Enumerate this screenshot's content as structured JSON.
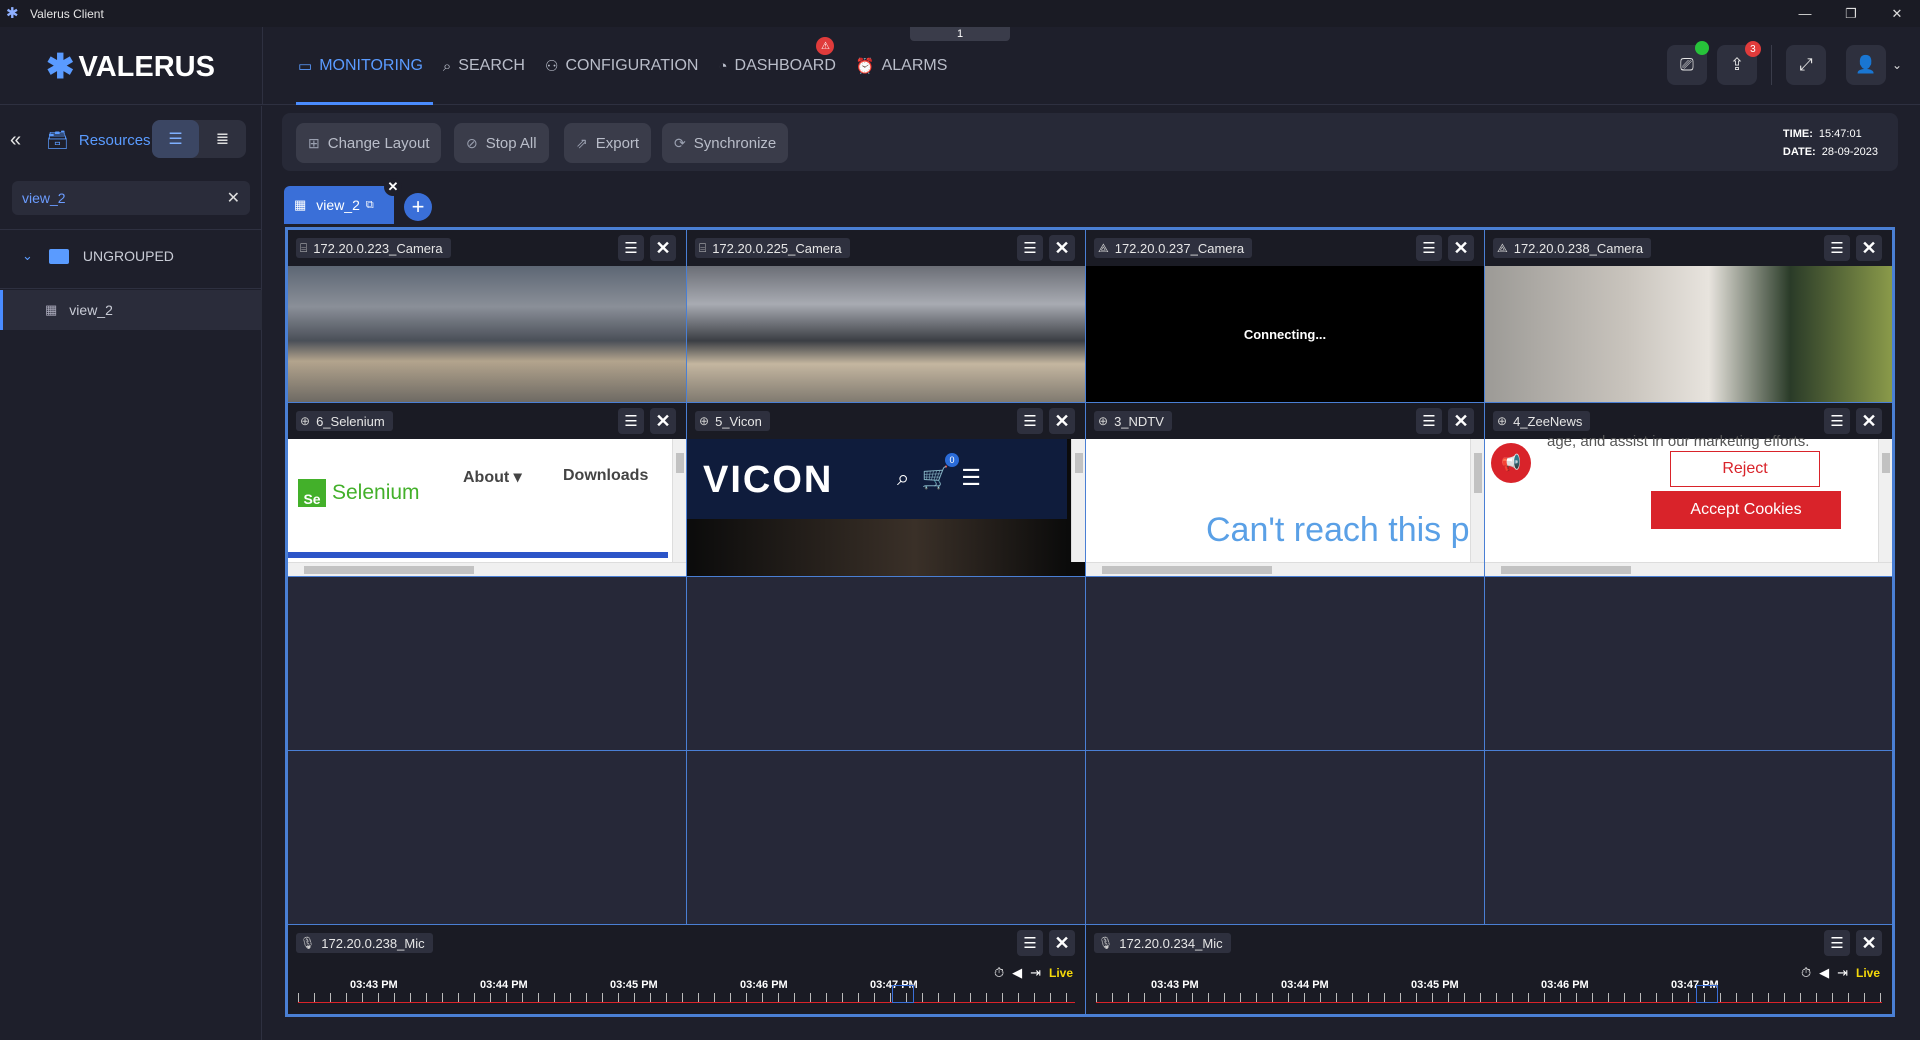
{
  "window": {
    "title": "Valerus Client",
    "minimize": "—",
    "maximize": "❐",
    "close": "✕"
  },
  "brand": {
    "name": "VALERUS"
  },
  "nav": [
    {
      "label": "MONITORING",
      "icon": "monitor-icon",
      "glyph": "▭",
      "active": true
    },
    {
      "label": "SEARCH",
      "icon": "search-icon",
      "glyph": "⌕"
    },
    {
      "label": "CONFIGURATION",
      "icon": "configuration-icon",
      "glyph": "⚇"
    },
    {
      "label": "DASHBOARD",
      "icon": "dashboard-icon",
      "glyph": "◔",
      "badge": "⚠"
    },
    {
      "label": "ALARMS",
      "icon": "alarm-icon",
      "glyph": "⏰"
    }
  ],
  "pager": {
    "value": "1"
  },
  "header_buttons": {
    "notifications_count": "3"
  },
  "sidebar": {
    "resources_label": "Resources",
    "search_value": "view_2",
    "group_label": "UNGROUPED",
    "item_label": "view_2"
  },
  "toolbar": {
    "change_layout": "Change Layout",
    "stop_all": "Stop All",
    "export": "Export",
    "synchronize": "Synchronize",
    "time_label": "TIME:",
    "time_value": "15:47:01",
    "date_label": "DATE:",
    "date_value": "28-09-2023"
  },
  "tab": {
    "label": "view_2"
  },
  "tiles": [
    {
      "label": "172.20.0.223_Camera",
      "icon": "camera-icon"
    },
    {
      "label": "172.20.0.225_Camera",
      "icon": "camera-icon"
    },
    {
      "label": "172.20.0.237_Camera",
      "icon": "camera-icon",
      "status": "Connecting..."
    },
    {
      "label": "172.20.0.238_Camera",
      "icon": "camera-icon"
    },
    {
      "label": "6_Selenium",
      "icon": "globe-icon"
    },
    {
      "label": "5_Vicon",
      "icon": "globe-icon"
    },
    {
      "label": "3_NDTV",
      "icon": "globe-icon"
    },
    {
      "label": "4_ZeeNews",
      "icon": "globe-icon"
    }
  ],
  "web": {
    "selenium": {
      "logo_mark": "Se",
      "logo_text": "Selenium",
      "nav_about": "About ▾",
      "nav_downloads": "Downloads"
    },
    "vicon": {
      "logo": "VICON",
      "cart_count": "0"
    },
    "ndtv": {
      "message": "Can't reach this p"
    },
    "zeenews": {
      "text": "age, and assist in our marketing efforts.",
      "reject": "Reject",
      "accept": "Accept Cookies"
    }
  },
  "mics": [
    {
      "label": "172.20.0.238_Mic",
      "live": "Live",
      "times": [
        "03:43 PM",
        "03:44 PM",
        "03:45 PM",
        "03:46 PM",
        "03:47 PM"
      ]
    },
    {
      "label": "172.20.0.234_Mic",
      "live": "Live",
      "times": [
        "03:43 PM",
        "03:44 PM",
        "03:45 PM",
        "03:46 PM",
        "03:47 PM"
      ]
    }
  ]
}
